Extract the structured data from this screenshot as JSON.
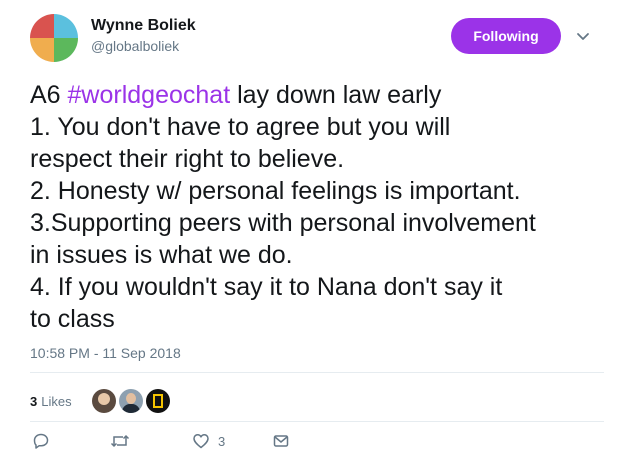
{
  "user": {
    "name": "Wynne Boliek",
    "handle": "@globalboliek"
  },
  "follow_button": {
    "label": "Following"
  },
  "tweet": {
    "lines": [
      {
        "prefix": "A6 ",
        "hashtag": "#worldgeochat",
        "suffix": " lay down law early"
      },
      {
        "text": "1. You don't have to agree but you will"
      },
      {
        "text": "respect their right to believe."
      },
      {
        "text": "2. Honesty w/ personal feelings is important."
      },
      {
        "text": "3.Supporting peers with personal involvement"
      },
      {
        "text": "in issues is what we do."
      },
      {
        "text": "4. If you wouldn't say it to Nana don't say it"
      },
      {
        "text": "to class"
      }
    ],
    "timestamp": "10:58 PM - 11 Sep 2018"
  },
  "stats": {
    "likes_count": "3",
    "likes_label": "Likes"
  },
  "actions": {
    "like_count": "3"
  },
  "colors": {
    "accent": "#9b33e8",
    "muted": "#657786",
    "text": "#14171a"
  },
  "icons": [
    "reply-icon",
    "retweet-icon",
    "like-icon",
    "message-icon",
    "chevron-down-icon"
  ]
}
